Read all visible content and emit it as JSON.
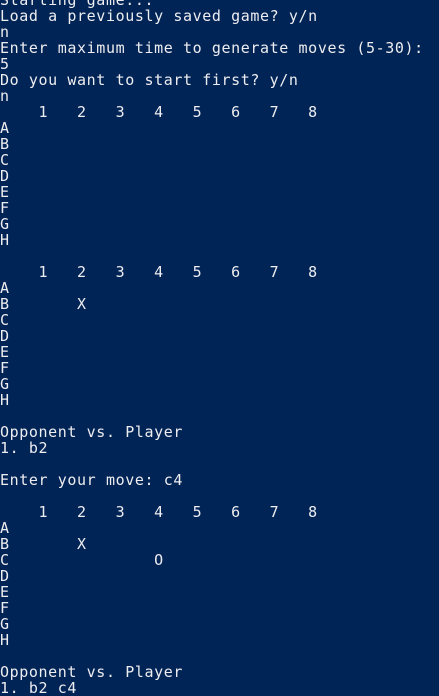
{
  "window": {
    "background": "#012456",
    "foreground": "#eeedf0"
  },
  "lines": [
    "Starting game...",
    "Load a previously saved game? y/n",
    "n",
    "Enter maximum time to generate moves (5-30):",
    "5",
    "Do you want to start first? y/n",
    "n",
    "    1   2   3   4   5   6   7   8",
    "A   _   _   _   _   _   _   _   _",
    "B   _   _   _   _   _   _   _   _",
    "C   _   _   _   _   _   _   _   _",
    "D   _   _   _   _   _   _   _   _",
    "E   _   _   _   _   _   _   _   _",
    "F   _   _   _   _   _   _   _   _",
    "G   _   _   _   _   _   _   _   _",
    "H   _   _   _   _   _   _   _   _",
    "",
    "    1   2   3   4   5   6   7   8",
    "A   _   _   _   _   _   _   _   _",
    "B   _   X   _   _   _   _   _   _",
    "C   _   _   _   _   _   _   _   _",
    "D   _   _   _   _   _   _   _   _",
    "E   _   _   _   _   _   _   _   _",
    "F   _   _   _   _   _   _   _   _",
    "G   _   _   _   _   _   _   _   _",
    "H   _   _   _   _   _   _   _   _",
    "",
    "Opponent vs. Player",
    "1. b2",
    "",
    "Enter your move: c4",
    "",
    "    1   2   3   4   5   6   7   8",
    "A   _   _   _   _   _   _   _   _",
    "B   _   X   _   _   _   _   _   _",
    "C   _   _   _   O   _   _   _   _",
    "D   _   _   _   _   _   _   _   _",
    "E   _   _   _   _   _   _   _   _",
    "F   _   _   _   _   _   _   _   _",
    "G   _   _   _   _   _   _   _   _",
    "H   _   _   _   _   _   _   _   _",
    "",
    "Opponent vs. Player",
    "1. b2 c4"
  ]
}
